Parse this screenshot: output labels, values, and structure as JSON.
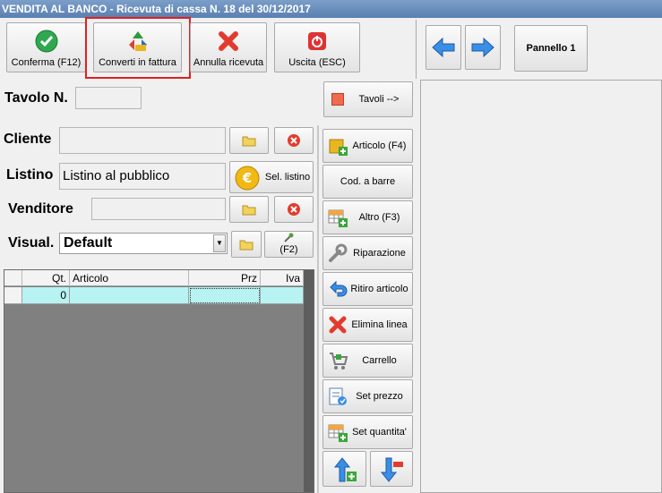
{
  "window": {
    "title": "VENDITA AL BANCO - Ricevuta di cassa N. 18 del 30/12/2017"
  },
  "toolbar": {
    "confirm_label": "Conferma (F12)",
    "convert_label": "Converti in fattura",
    "cancel_label": "Annulla ricevuta",
    "exit_label": "Uscita (ESC)",
    "panel_label": "Pannello 1"
  },
  "form": {
    "tavolo_label": "Tavolo N.",
    "tavolo_value": "",
    "tavoli_button": "Tavoli -->",
    "cliente_label": "Cliente",
    "cliente_value": "",
    "listino_label": "Listino",
    "listino_value": "Listino al pubblico",
    "sel_listino_button": "Sel. listino",
    "venditore_label": "Venditore",
    "venditore_value": "",
    "visual_label": "Visual.",
    "visual_value": "Default",
    "f2_label": "(F2)"
  },
  "grid": {
    "columns": [
      "Qt.",
      "Articolo",
      "Prz",
      "Iva"
    ],
    "rows": [
      {
        "qt": "0",
        "articolo": "",
        "prz": "",
        "iva": ""
      }
    ]
  },
  "side_buttons": {
    "articolo": "Articolo (F4)",
    "cod_barre": "Cod. a barre",
    "altro": "Altro (F3)",
    "riparazione": "Riparazione",
    "ritiro": "Ritiro articolo",
    "elimina": "Elimina linea",
    "carrello": "Carrello",
    "set_prezzo": "Set prezzo",
    "set_quantita": "Set quantita'"
  },
  "icons": {
    "confirm": "check-icon",
    "convert": "recycle-icon",
    "cancel": "x-icon",
    "exit": "power-icon",
    "folder": "folder-icon",
    "clear": "clear-icon",
    "euro": "euro-coin-icon",
    "nav_back": "arrow-left-icon",
    "nav_forward": "arrow-right-icon"
  },
  "colors": {
    "title_bar": "#6a8fc0",
    "highlight": "#e02020",
    "grid_row": "#b7f3f3"
  }
}
